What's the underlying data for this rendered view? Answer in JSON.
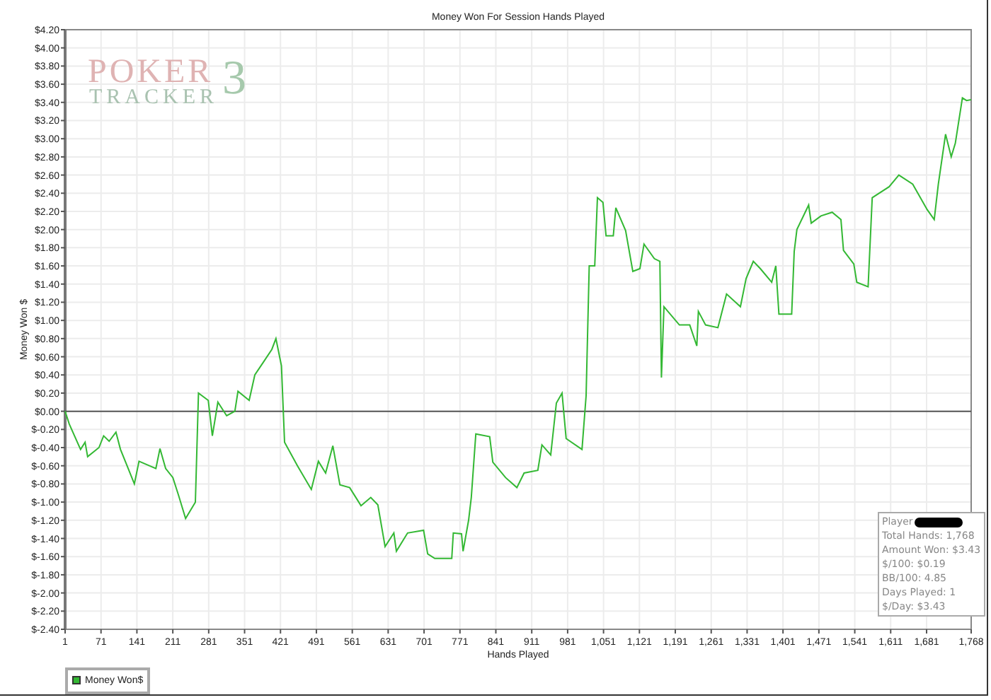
{
  "logo": {
    "word_top": "POKER",
    "word_bottom": "TRACKER",
    "numeral": "3"
  },
  "chart_data": {
    "type": "line",
    "grid": true,
    "title": "Money Won For Session Hands Played",
    "xlabel": "Hands Played",
    "ylabel": "Money Won $",
    "xlim": [
      1,
      1768
    ],
    "ylim": [
      -2.4,
      4.2
    ],
    "xticks": [
      {
        "value": 1,
        "label": "1"
      },
      {
        "value": 71,
        "label": "71"
      },
      {
        "value": 141,
        "label": "141"
      },
      {
        "value": 211,
        "label": "211"
      },
      {
        "value": 281,
        "label": "281"
      },
      {
        "value": 351,
        "label": "351"
      },
      {
        "value": 421,
        "label": "421"
      },
      {
        "value": 491,
        "label": "491"
      },
      {
        "value": 561,
        "label": "561"
      },
      {
        "value": 631,
        "label": "631"
      },
      {
        "value": 701,
        "label": "701"
      },
      {
        "value": 771,
        "label": "771"
      },
      {
        "value": 841,
        "label": "841"
      },
      {
        "value": 911,
        "label": "911"
      },
      {
        "value": 981,
        "label": "981"
      },
      {
        "value": 1051,
        "label": "1,051"
      },
      {
        "value": 1121,
        "label": "1,121"
      },
      {
        "value": 1191,
        "label": "1,191"
      },
      {
        "value": 1261,
        "label": "1,261"
      },
      {
        "value": 1331,
        "label": "1,331"
      },
      {
        "value": 1401,
        "label": "1,401"
      },
      {
        "value": 1471,
        "label": "1,471"
      },
      {
        "value": 1541,
        "label": "1,541"
      },
      {
        "value": 1611,
        "label": "1,611"
      },
      {
        "value": 1681,
        "label": "1,681"
      },
      {
        "value": 1768,
        "label": "1,768"
      }
    ],
    "yticks": [
      {
        "value": 4.2,
        "label": "$4.20"
      },
      {
        "value": 4.0,
        "label": "$4.00"
      },
      {
        "value": 3.8,
        "label": "$3.80"
      },
      {
        "value": 3.6,
        "label": "$3.60"
      },
      {
        "value": 3.4,
        "label": "$3.40"
      },
      {
        "value": 3.2,
        "label": "$3.20"
      },
      {
        "value": 3.0,
        "label": "$3.00"
      },
      {
        "value": 2.8,
        "label": "$2.80"
      },
      {
        "value": 2.6,
        "label": "$2.60"
      },
      {
        "value": 2.4,
        "label": "$2.40"
      },
      {
        "value": 2.2,
        "label": "$2.20"
      },
      {
        "value": 2.0,
        "label": "$2.00"
      },
      {
        "value": 1.8,
        "label": "$1.80"
      },
      {
        "value": 1.6,
        "label": "$1.60"
      },
      {
        "value": 1.4,
        "label": "$1.40"
      },
      {
        "value": 1.2,
        "label": "$1.20"
      },
      {
        "value": 1.0,
        "label": "$1.00"
      },
      {
        "value": 0.8,
        "label": "$0.80"
      },
      {
        "value": 0.6,
        "label": "$0.60"
      },
      {
        "value": 0.4,
        "label": "$0.40"
      },
      {
        "value": 0.2,
        "label": "$0.20"
      },
      {
        "value": 0,
        "label": "$0.00"
      },
      {
        "value": -0.2,
        "label": "$-0.20"
      },
      {
        "value": -0.4,
        "label": "$-0.40"
      },
      {
        "value": -0.6,
        "label": "$-0.60"
      },
      {
        "value": -0.8,
        "label": "$-0.80"
      },
      {
        "value": -1.0,
        "label": "$-1.00"
      },
      {
        "value": -1.2,
        "label": "$-1.20"
      },
      {
        "value": -1.4,
        "label": "$-1.40"
      },
      {
        "value": -1.6,
        "label": "$-1.60"
      },
      {
        "value": -1.8,
        "label": "$-1.80"
      },
      {
        "value": -2.0,
        "label": "$-2.00"
      },
      {
        "value": -2.2,
        "label": "$-2.20"
      },
      {
        "value": -2.4,
        "label": "$-2.40"
      }
    ],
    "x": [
      1,
      9,
      31,
      40,
      45,
      67,
      76,
      87,
      100,
      109,
      122,
      136,
      145,
      178,
      186,
      197,
      211,
      222,
      236,
      255,
      261,
      280,
      288,
      299,
      316,
      332,
      338,
      360,
      371,
      390,
      404,
      412,
      423,
      429,
      454,
      481,
      495,
      509,
      523,
      537,
      556,
      578,
      597,
      611,
      625,
      642,
      647,
      669,
      700,
      708,
      722,
      755,
      758,
      774,
      777,
      788,
      793,
      802,
      829,
      835,
      860,
      882,
      896,
      923,
      931,
      948,
      959,
      970,
      978,
      1009,
      1017,
      1023,
      1034,
      1039,
      1050,
      1056,
      1070,
      1075,
      1094,
      1108,
      1122,
      1130,
      1150,
      1161,
      1164,
      1169,
      1199,
      1219,
      1233,
      1236,
      1250,
      1274,
      1291,
      1318,
      1329,
      1343,
      1357,
      1379,
      1387,
      1393,
      1418,
      1423,
      1428,
      1451,
      1456,
      1475,
      1497,
      1514,
      1519,
      1539,
      1545,
      1567,
      1575,
      1608,
      1627,
      1654,
      1682,
      1696,
      1704,
      1718,
      1729,
      1737,
      1751,
      1759,
      1768
    ],
    "series": [
      {
        "name": "Money Won$",
        "color": "#33b833",
        "values": [
          0,
          -0.14,
          -0.42,
          -0.34,
          -0.5,
          -0.4,
          -0.27,
          -0.33,
          -0.23,
          -0.42,
          -0.6,
          -0.8,
          -0.55,
          -0.63,
          -0.41,
          -0.63,
          -0.73,
          -0.92,
          -1.18,
          -1.0,
          0.2,
          0.12,
          -0.27,
          0.1,
          -0.05,
          0.0,
          0.22,
          0.12,
          0.4,
          0.56,
          0.68,
          0.8,
          0.5,
          -0.34,
          -0.6,
          -0.86,
          -0.55,
          -0.68,
          -0.38,
          -0.81,
          -0.84,
          -1.04,
          -0.95,
          -1.03,
          -1.49,
          -1.34,
          -1.54,
          -1.34,
          -1.31,
          -1.57,
          -1.62,
          -1.62,
          -1.34,
          -1.35,
          -1.54,
          -1.2,
          -0.95,
          -0.25,
          -0.28,
          -0.56,
          -0.73,
          -0.84,
          -0.68,
          -0.65,
          -0.37,
          -0.48,
          0.09,
          0.2,
          -0.3,
          -0.42,
          0.17,
          1.6,
          1.6,
          2.35,
          2.3,
          1.93,
          1.93,
          2.24,
          1.99,
          1.54,
          1.57,
          1.84,
          1.68,
          1.65,
          0.37,
          1.15,
          0.95,
          0.95,
          0.72,
          1.1,
          0.95,
          0.92,
          1.29,
          1.15,
          1.46,
          1.65,
          1.57,
          1.42,
          1.6,
          1.07,
          1.07,
          1.76,
          2.0,
          2.27,
          2.07,
          2.15,
          2.19,
          2.11,
          1.77,
          1.62,
          1.42,
          1.37,
          2.35,
          2.47,
          2.6,
          2.5,
          2.22,
          2.11,
          2.5,
          3.05,
          2.8,
          2.95,
          3.45,
          3.42,
          3.43
        ]
      }
    ]
  },
  "stats": [
    "Player",
    "Total Hands: 1,768",
    "Amount Won: $3.43",
    "$/100: $0.19",
    "BB/100: 4.85",
    "Days Played: 1",
    "$/Day: $3.43"
  ]
}
